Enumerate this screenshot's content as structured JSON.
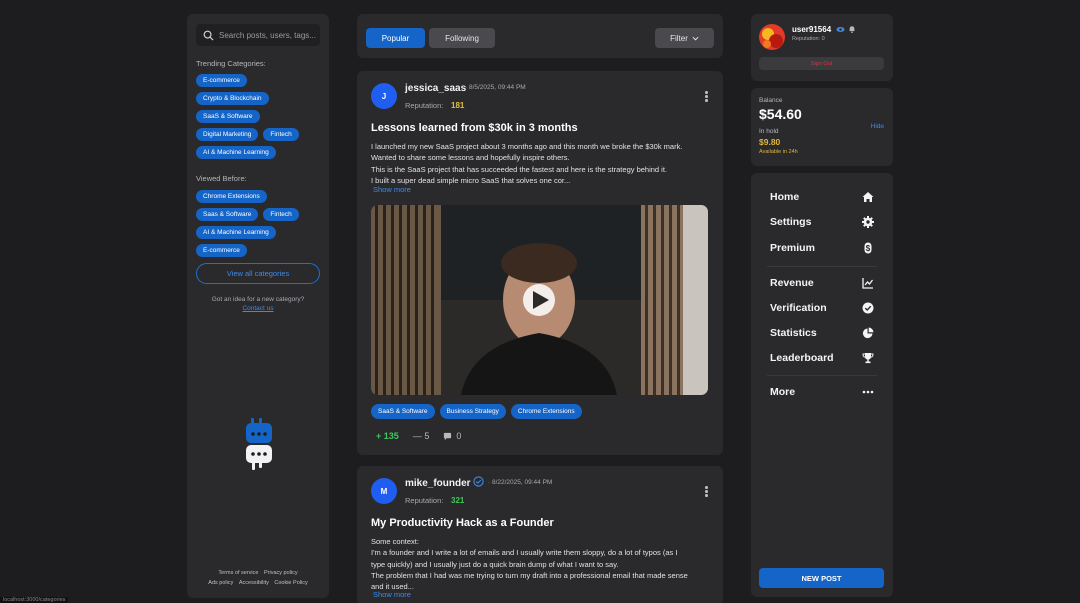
{
  "search": {
    "placeholder": "Search posts, users, tags..."
  },
  "sidebar": {
    "trending_title": "Trending Categories:",
    "trending": [
      "E-commerce",
      "Crypto & Blockchain",
      "SaaS & Software",
      "Digital Marketing",
      "Fintech",
      "AI & Machine Learning"
    ],
    "viewed_title": "Viewed Before:",
    "viewed": [
      "Chrome Extensions",
      "Saas & Software",
      "Fintech",
      "AI & Machine Learning",
      "E-commerce"
    ],
    "view_all": "View all categories",
    "idea_text": "Got an idea for a new category?",
    "contact": "Contact us",
    "footer_row1": [
      "Terms of service",
      "Privacy policy"
    ],
    "footer_row2": [
      "Ads policy",
      "Accessibility",
      "Cookie Policy"
    ]
  },
  "feed": {
    "tab_popular": "Popular",
    "tab_following": "Following",
    "filter": "Filter"
  },
  "posts": [
    {
      "avatar_letter": "J",
      "author": "jessica_saas",
      "date": "· 8/5/2025, 09:44 PM",
      "rep_label": "Reputation:",
      "reputation": "181",
      "rep_color": "#e0c23a",
      "title": "Lessons learned from $30k in 3 months",
      "body": [
        "I launched my new SaaS project about 3 months ago and this month we broke the $30k mark.",
        "Wanted to share some lessons and hopefully inspire others.",
        "This is the SaaS project that has succeeded the fastest and here is the strategy behind it.",
        "I built a super dead simple micro SaaS that solves one cor..."
      ],
      "show_more": "Show more",
      "tags": [
        "SaaS & Software",
        "Business Strategy",
        "Chrome Extensions"
      ],
      "upvotes": "135",
      "downvotes": "5",
      "comments": "0"
    },
    {
      "avatar_letter": "M",
      "author": "mike_founder",
      "date": "· 8/22/2025, 09:44 PM",
      "rep_label": "Reputation:",
      "reputation": "321",
      "rep_color": "#3ec85a",
      "title": "My Productivity Hack as a Founder",
      "body": [
        "Some context:",
        "I'm a founder and I write a lot of emails and I usually write them sloppy, do a lot of typos (as I",
        "type quickly) and I usually just do a quick brain dump of what I want to say.",
        "The problem that I had was me trying to turn my draft into a professional email that made sense",
        "and it used..."
      ],
      "show_more": "Show more"
    }
  ],
  "profile": {
    "username": "user91564",
    "reputation": "Reputation: 0",
    "sign_out": "Sign Out"
  },
  "balance": {
    "label": "Balance",
    "amount": "$54.60",
    "hold_label": "In hold",
    "hold_amount": "$9.80",
    "available": "Available in 24h",
    "hide": "Hide"
  },
  "nav": {
    "home": "Home",
    "settings": "Settings",
    "premium": "Premium",
    "revenue": "Revenue",
    "verification": "Verification",
    "statistics": "Statistics",
    "leaderboard": "Leaderboard",
    "more": "More",
    "new_post": "NEW POST"
  },
  "status_url": "localhost:3000/categories"
}
